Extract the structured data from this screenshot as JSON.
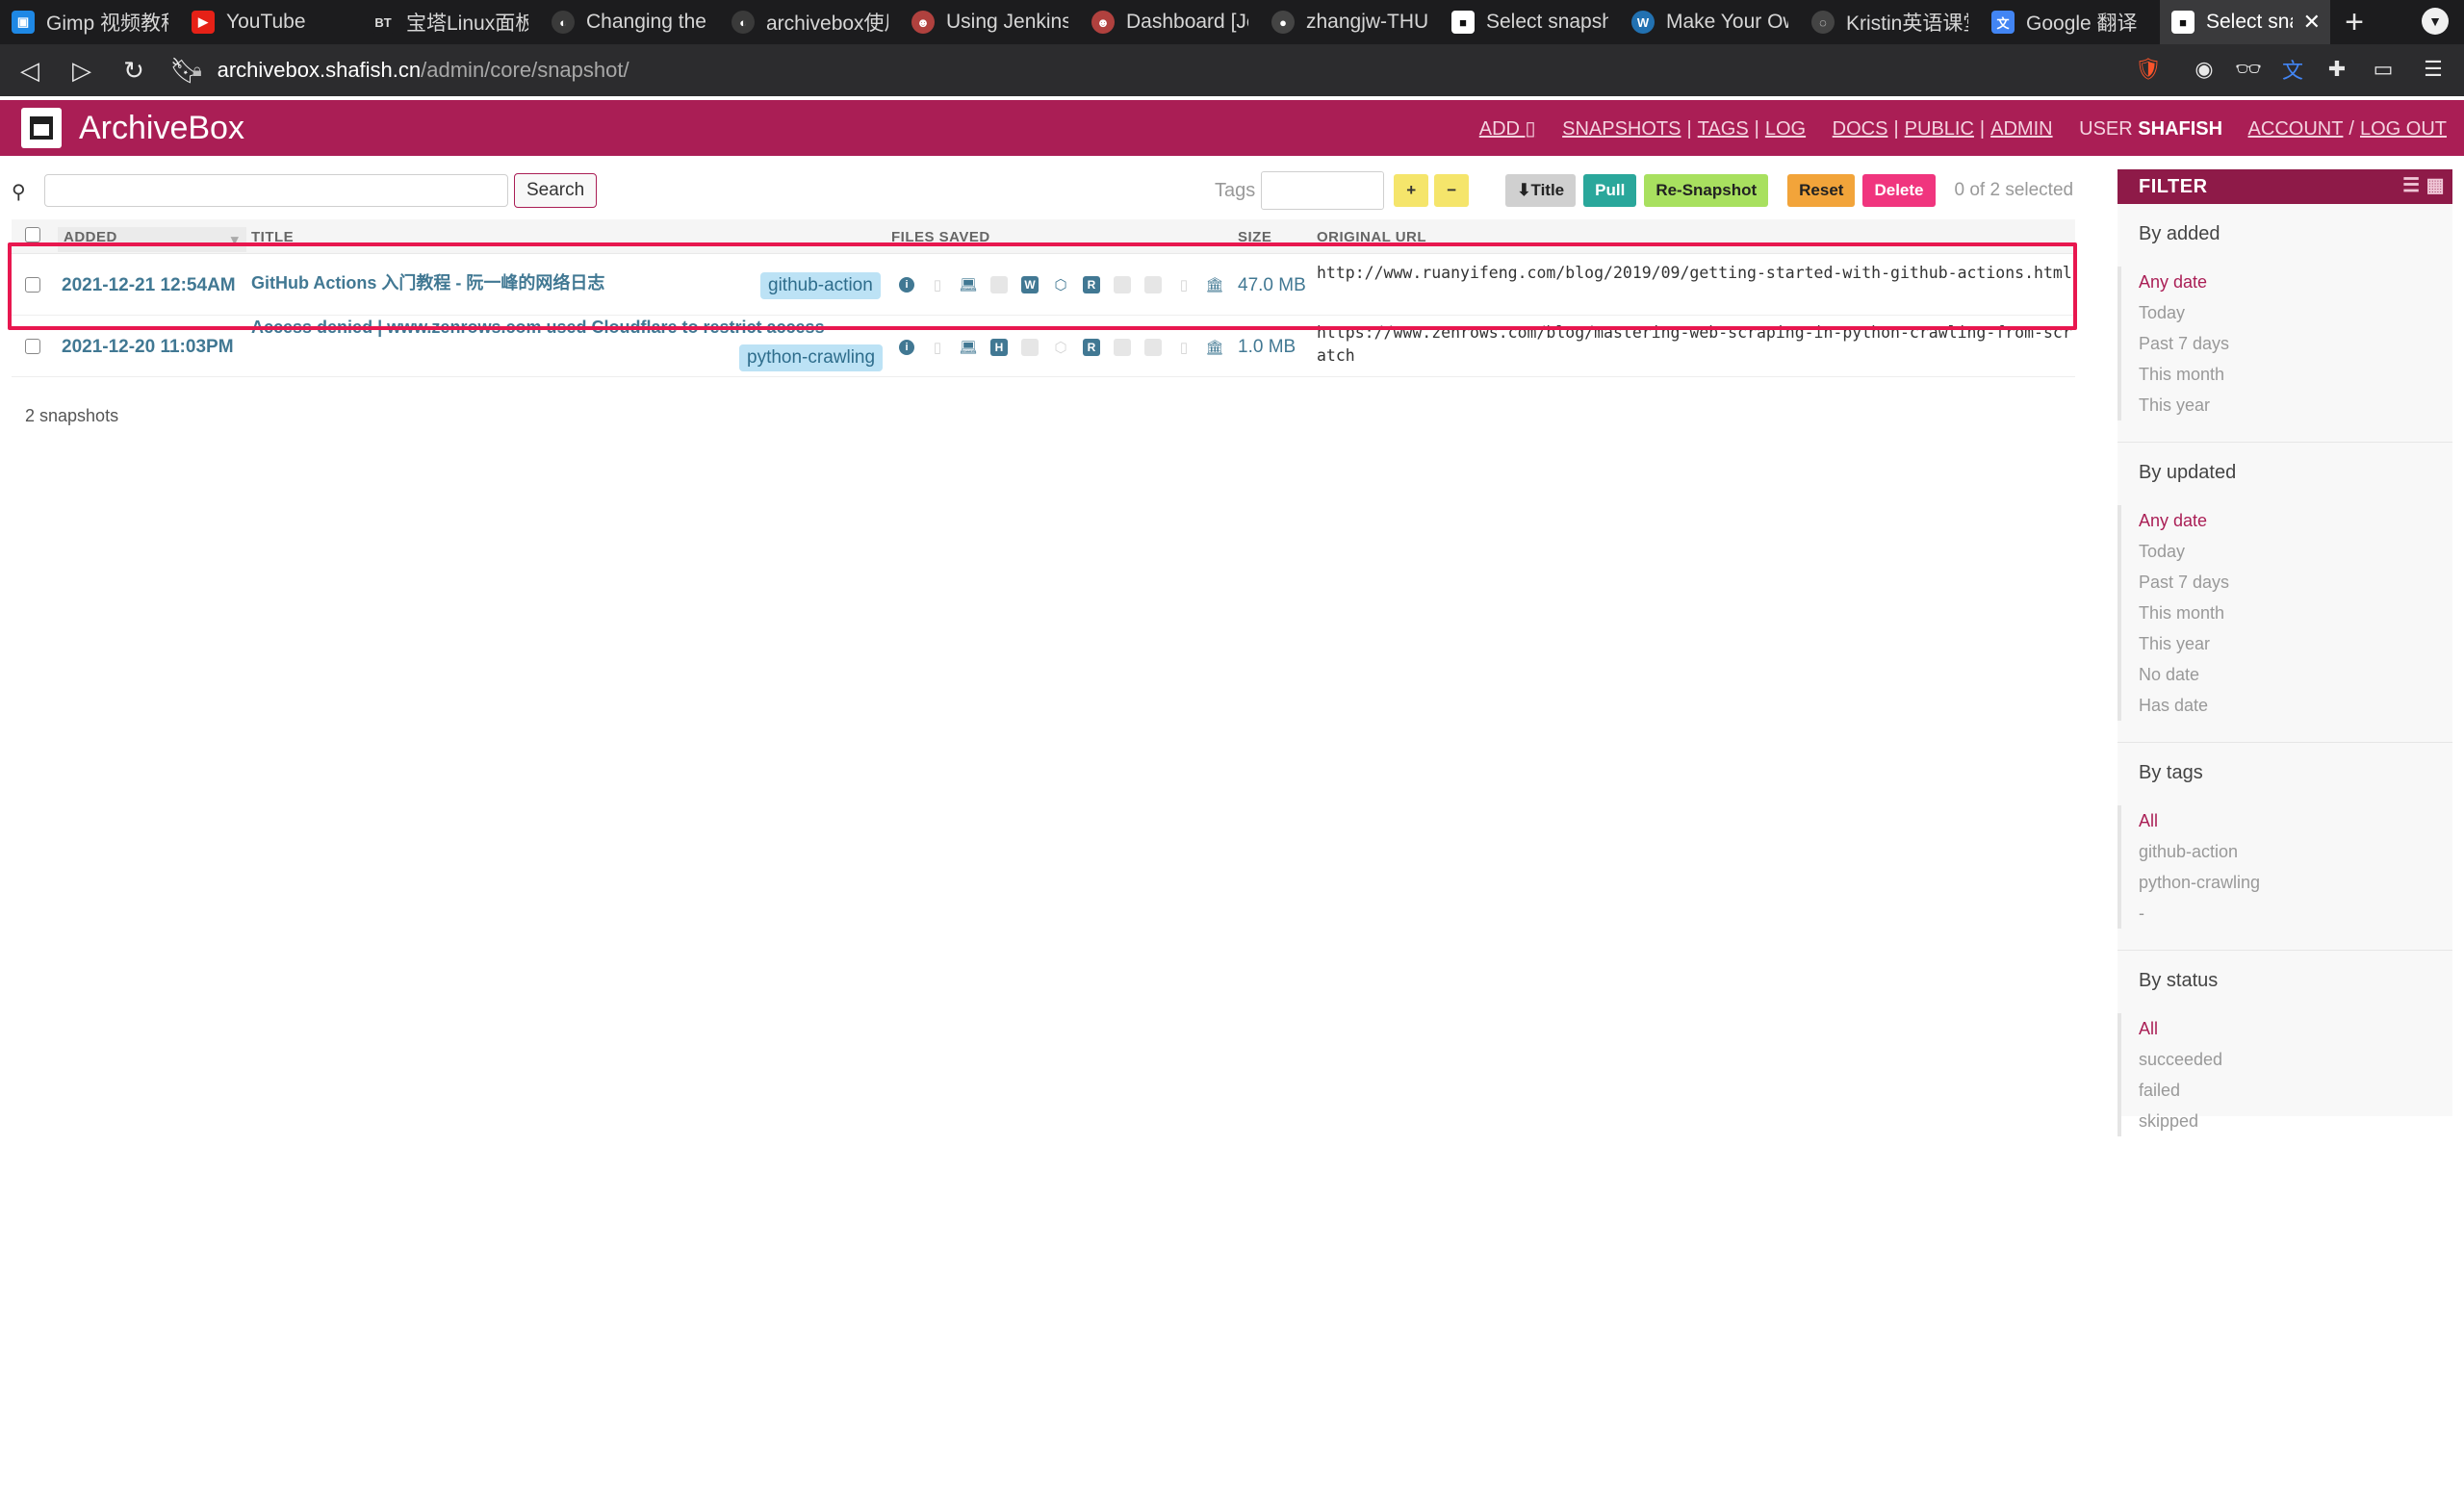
{
  "browser": {
    "tabs": [
      {
        "label": "Gimp 视频教程",
        "fav": "📺",
        "color": "#1e88e5"
      },
      {
        "label": "YouTube",
        "fav": "▶",
        "color": "#e62117"
      },
      {
        "label": "宝塔Linux面板",
        "fav": "BT",
        "color": "#2b2b2b"
      },
      {
        "label": "Changing the",
        "fav": "◐",
        "color": "#555555"
      },
      {
        "label": "archivebox使用",
        "fav": "◐",
        "color": "#555555"
      },
      {
        "label": "Using Jenkins",
        "fav": "☻",
        "color": "#b0413e"
      },
      {
        "label": "Dashboard [Je",
        "fav": "☻",
        "color": "#b0413e"
      },
      {
        "label": "zhangjw-THU/",
        "fav": "●",
        "color": "#333333"
      },
      {
        "label": "Select snapsho",
        "fav": "■",
        "color": "#ffffff"
      },
      {
        "label": "Make Your Ow",
        "fav": "W",
        "color": "#2271b1"
      },
      {
        "label": "Kristin英语课堂",
        "fav": "◌",
        "color": "#444444"
      },
      {
        "label": "Google 翻译",
        "fav": "文",
        "color": "#4285f4"
      },
      {
        "label": "Select snap",
        "fav": "■",
        "color": "#ffffff"
      }
    ],
    "new_tab": "+",
    "url_host": "archivebox.shafish.cn",
    "url_path": "/admin/core/snapshot/"
  },
  "app": {
    "title": "ArchiveBox",
    "nav": {
      "add": "ADD ▯",
      "snapshots": "SNAPSHOTS",
      "tags": "TAGS",
      "log": "LOG",
      "docs": "DOCS",
      "public": "PUBLIC",
      "admin": "ADMIN",
      "user_label": "USER",
      "user_name": "SHAFISH",
      "account": "ACCOUNT",
      "logout": "LOG OUT",
      "sep1": "|",
      "sep2": "|",
      "sep3": "|",
      "sep4": "|",
      "sep5": "/"
    }
  },
  "toolbar": {
    "search_button": "Search",
    "tags_label": "Tags",
    "plus": "+",
    "minus": "−",
    "title_btn": "⬇Title",
    "pull_btn": "Pull",
    "resnapshot_btn": "Re-Snapshot",
    "reset_btn": "Reset",
    "delete_btn": "Delete",
    "selected_count": "0 of 2 selected"
  },
  "table": {
    "headers": {
      "added": "ADDED",
      "title": "TITLE",
      "files": "FILES SAVED",
      "size": "SIZE",
      "url": "ORIGINAL URL"
    },
    "rows": [
      {
        "added": "2021-12-21 12:54AM",
        "title": "GitHub Actions 入门教程 - 阮一峰的网络日志",
        "tag": "github-action",
        "size": "47.0 MB",
        "url": "http://www.ruanyifeng.com/blog/2019/09/getting-started-with-github-actions.html"
      },
      {
        "added": "2021-12-20 11:03PM",
        "title": "Access denied | www.zenrows.com used Cloudflare to restrict access",
        "tag": "python-crawling",
        "size": "1.0 MB",
        "url": "https://www.zenrows.com/blog/mastering-web-scraping-in-python-crawling-from-scratch"
      }
    ],
    "footer": "2 snapshots"
  },
  "filter": {
    "title": "FILTER",
    "by_added": {
      "heading": "By added",
      "options": [
        "Any date",
        "Today",
        "Past 7 days",
        "This month",
        "This year"
      ]
    },
    "by_updated": {
      "heading": "By updated",
      "options": [
        "Any date",
        "Today",
        "Past 7 days",
        "This month",
        "This year",
        "No date",
        "Has date"
      ]
    },
    "by_tags": {
      "heading": "By tags",
      "options": [
        "All",
        "github-action",
        "python-crawling",
        "-"
      ]
    },
    "by_status": {
      "heading": "By status",
      "options": [
        "All",
        "succeeded",
        "failed",
        "skipped"
      ]
    }
  },
  "colors": {
    "brand": "#aa1e55",
    "link": "#417893",
    "highlight": "#e8174f"
  }
}
